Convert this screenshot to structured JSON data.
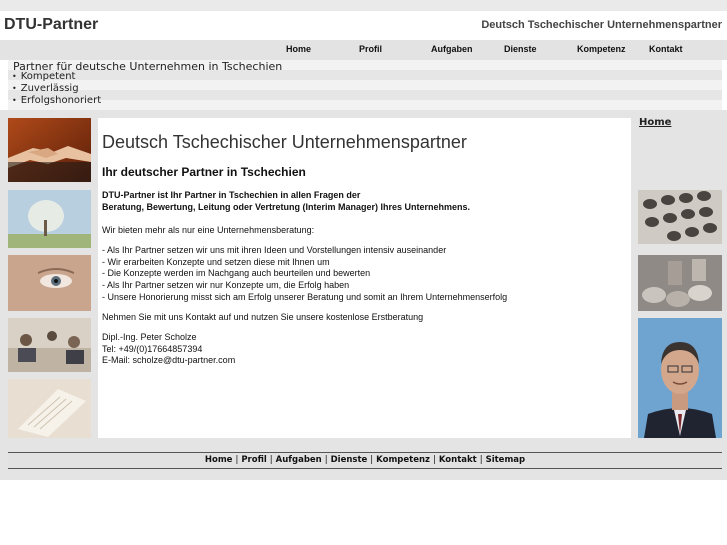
{
  "site": {
    "logo": "DTU-Partner",
    "tagline": "Deutsch Tschechischer Unternehmenspartner"
  },
  "nav": [
    {
      "label": "Home"
    },
    {
      "label": "Profil"
    },
    {
      "label": "Aufgaben"
    },
    {
      "label": "Dienste"
    },
    {
      "label": "Kompetenz"
    },
    {
      "label": "Kontakt"
    }
  ],
  "intro": {
    "title": "Partner für deutsche Unternehmen in Tschechien",
    "items": [
      "Kompetent",
      "Zuverlässig",
      "Erfolgshonoriert"
    ]
  },
  "content": {
    "heading": "Deutsch Tschechischer Unternehmenspartner",
    "subheading": "Ihr deutscher Partner in Tschechien",
    "lead_line1": "DTU-Partner ist Ihr Partner in Tschechien in allen Fragen der",
    "lead_line2": "Beratung, Bewertung, Leitung oder Vertretung (Interim Manager) Ihres Unternehmens.",
    "offer_intro": "Wir bieten mehr als nur eine Unternehmensberatung:",
    "bullets": [
      "- Als Ihr Partner setzen wir uns mit ihren Ideen und Vorstellungen intensiv auseinander",
      "- Wir erarbeiten Konzepte und setzen diese mit Ihnen um",
      "- Die Konzepte werden im Nachgang auch beurteilen und bewerten",
      "- Als Ihr Partner setzen wir nur Konzepte um, die Erfolg haben",
      "- Unsere Honorierung misst sich am Erfolg unserer Beratung und somit an Ihrem Unternehmenserfolg"
    ],
    "cta": "Nehmen Sie mit uns Kontakt auf und nutzen Sie unsere kostenlose Erstberatung",
    "contact_name": "Dipl.-Ing. Peter Scholze",
    "contact_tel": "Tel: +49/(0)17664857394",
    "contact_email": "E-Mail: scholze@dtu-partner.com"
  },
  "sidebar_right": {
    "home_link": "Home"
  },
  "footer": {
    "links": [
      "Home",
      "Profil",
      "Aufgaben",
      "Dienste",
      "Kompetenz",
      "Kontakt",
      "Sitemap"
    ],
    "separator": "|"
  },
  "colors": {
    "background_band": "#e4e4e4",
    "nav_bg": "#e3e3e3",
    "text": "#222222"
  }
}
